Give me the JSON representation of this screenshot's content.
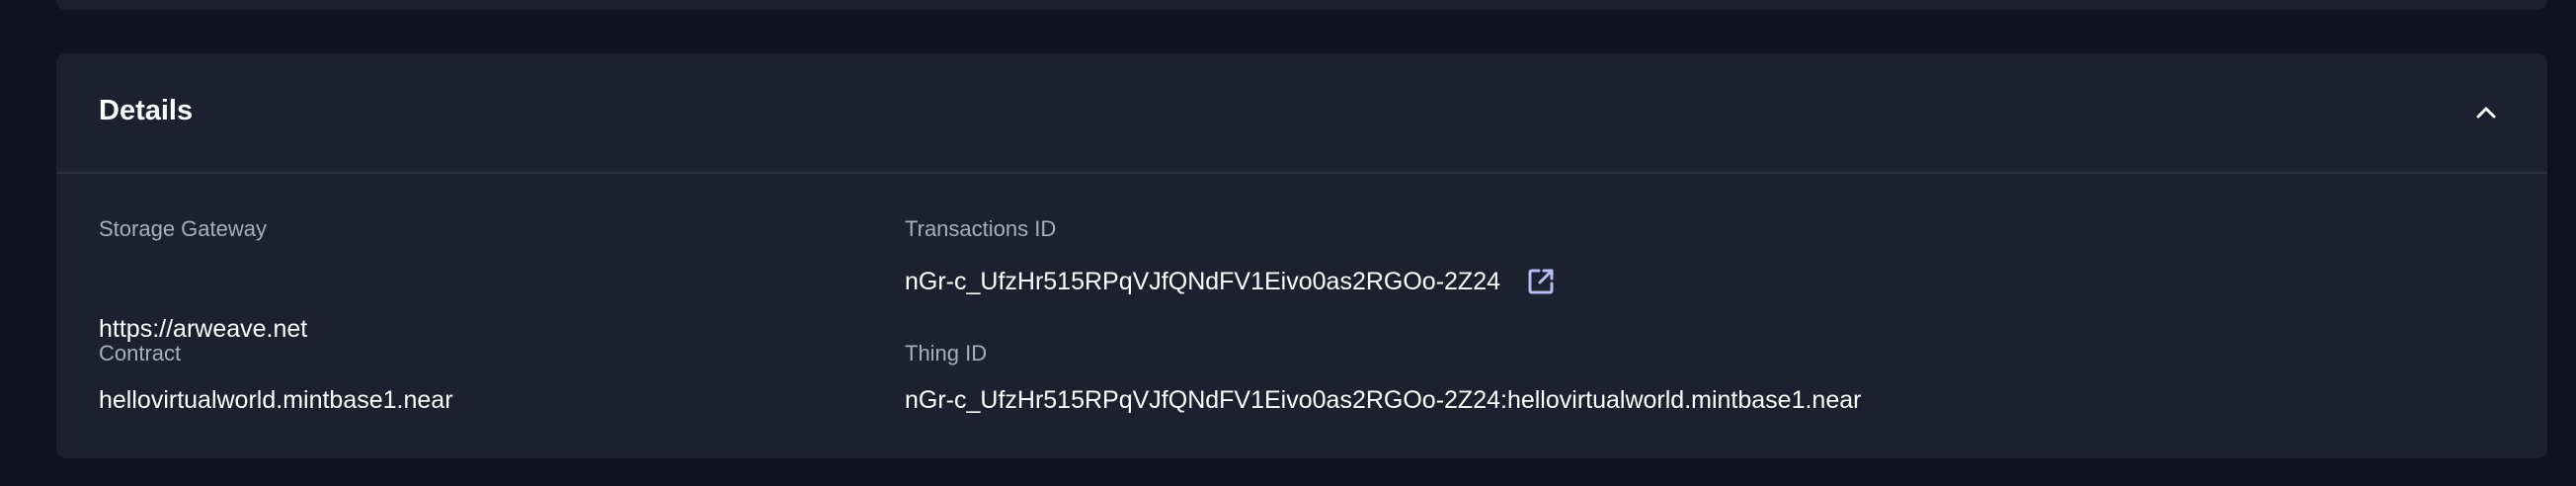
{
  "details": {
    "title": "Details",
    "collapse_icon": "chevron-up-icon",
    "fields": {
      "storage_gateway": {
        "label": "Storage Gateway",
        "value": "https://arweave.net"
      },
      "transactions_id": {
        "label": "Transactions ID",
        "value": "nGr-c_UfzHr515RPqVJfQNdFV1Eivo0as2RGOo-2Z24",
        "link_icon": "external-link-icon"
      },
      "contract": {
        "label": "Contract",
        "value": "hellovirtualworld.mintbase1.near"
      },
      "thing_id": {
        "label": "Thing ID",
        "value": "nGr-c_UfzHr515RPqVJfQNdFV1Eivo0as2RGOo-2Z24:hellovirtualworld.mintbase1.near"
      }
    }
  },
  "colors": {
    "page_background": "#10131f",
    "card_background": "#1d202e",
    "label_text": "#a9adbd",
    "value_text": "#ffffff",
    "link_icon": "#b7baf5"
  }
}
